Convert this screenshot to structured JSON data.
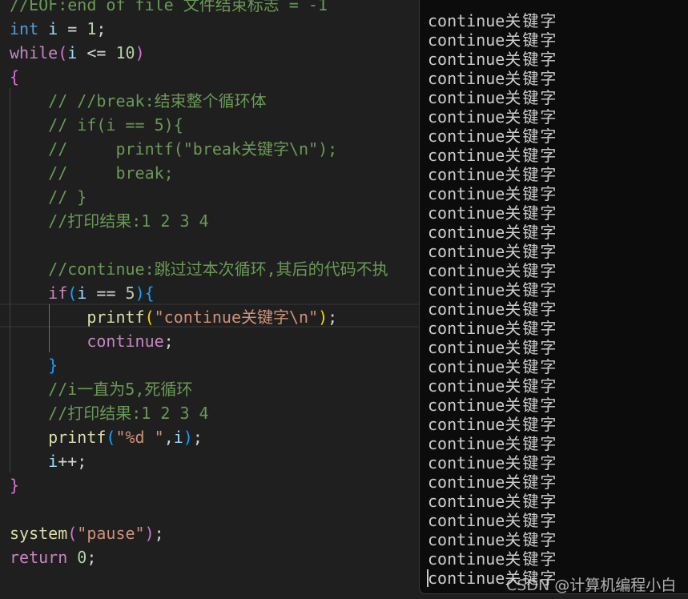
{
  "editor": {
    "lines": [
      [
        [
          "//EOF:end of file 文件结束标志 = -1",
          "comment"
        ]
      ],
      [
        [
          "int",
          "kw"
        ],
        [
          " ",
          "plain"
        ],
        [
          "i",
          "var"
        ],
        [
          " = ",
          "plain"
        ],
        [
          "1",
          "num"
        ],
        [
          ";",
          "plain"
        ]
      ],
      [
        [
          "while",
          "ctrl"
        ],
        [
          "(",
          "b1"
        ],
        [
          "i",
          "var"
        ],
        [
          " <= ",
          "plain"
        ],
        [
          "10",
          "num"
        ],
        [
          ")",
          "b1"
        ]
      ],
      [
        [
          "{",
          "b1"
        ]
      ],
      [
        [
          "    // //break:结束整个循环体",
          "comment"
        ]
      ],
      [
        [
          "    // if(i == 5){",
          "comment"
        ]
      ],
      [
        [
          "    //     printf(\"break关键字\\n\");",
          "comment"
        ]
      ],
      [
        [
          "    //     break;",
          "comment"
        ]
      ],
      [
        [
          "    // }",
          "comment"
        ]
      ],
      [
        [
          "    //打印结果:1 2 3 4",
          "comment"
        ]
      ],
      [],
      [
        [
          "    //continue:跳过过本次循环,其后的代码不执",
          "comment"
        ]
      ],
      [
        [
          "    ",
          "plain"
        ],
        [
          "if",
          "ctrl"
        ],
        [
          "(",
          "b2"
        ],
        [
          "i",
          "var"
        ],
        [
          " == ",
          "plain"
        ],
        [
          "5",
          "num"
        ],
        [
          ")",
          "b2"
        ],
        [
          "{",
          "b2"
        ]
      ],
      [
        [
          "        ",
          "plain"
        ],
        [
          "printf",
          "fn"
        ],
        [
          "(",
          "b3"
        ],
        [
          "\"continue关键字\\n\"",
          "str"
        ],
        [
          ")",
          "b3"
        ],
        [
          ";",
          "plain"
        ]
      ],
      [
        [
          "        ",
          "plain"
        ],
        [
          "continue",
          "ctrl"
        ],
        [
          ";",
          "plain"
        ]
      ],
      [
        [
          "    ",
          "plain"
        ],
        [
          "}",
          "b2"
        ]
      ],
      [
        [
          "    //i一直为5,死循环",
          "comment"
        ]
      ],
      [
        [
          "    //打印结果:1 2 3 4",
          "comment"
        ]
      ],
      [
        [
          "    ",
          "plain"
        ],
        [
          "printf",
          "fn"
        ],
        [
          "(",
          "b2"
        ],
        [
          "\"%d \"",
          "str"
        ],
        [
          ",",
          "plain"
        ],
        [
          "i",
          "var"
        ],
        [
          ")",
          "b2"
        ],
        [
          ";",
          "plain"
        ]
      ],
      [
        [
          "    ",
          "plain"
        ],
        [
          "i",
          "var"
        ],
        [
          "++;",
          "plain"
        ]
      ],
      [
        [
          "}",
          "b1"
        ]
      ],
      [],
      [
        [
          "system",
          "fn"
        ],
        [
          "(",
          "b1"
        ],
        [
          "\"pause\"",
          "str"
        ],
        [
          ")",
          "b1"
        ],
        [
          ";",
          "plain"
        ]
      ],
      [
        [
          "return",
          "ctrl"
        ],
        [
          " ",
          "plain"
        ],
        [
          "0",
          "num"
        ],
        [
          ";",
          "plain"
        ]
      ]
    ],
    "colors": {
      "background": "#1f1f1f",
      "comment": "#6a9955",
      "keyword": "#569cd6",
      "control": "#c586c0",
      "string": "#ce9178",
      "function": "#dcdcaa"
    }
  },
  "console": {
    "output_word": "continue",
    "output_cjk": "关键字",
    "line_count": 30,
    "background": "#0c0c0c"
  },
  "watermark": "CSDN @计算机编程小白"
}
